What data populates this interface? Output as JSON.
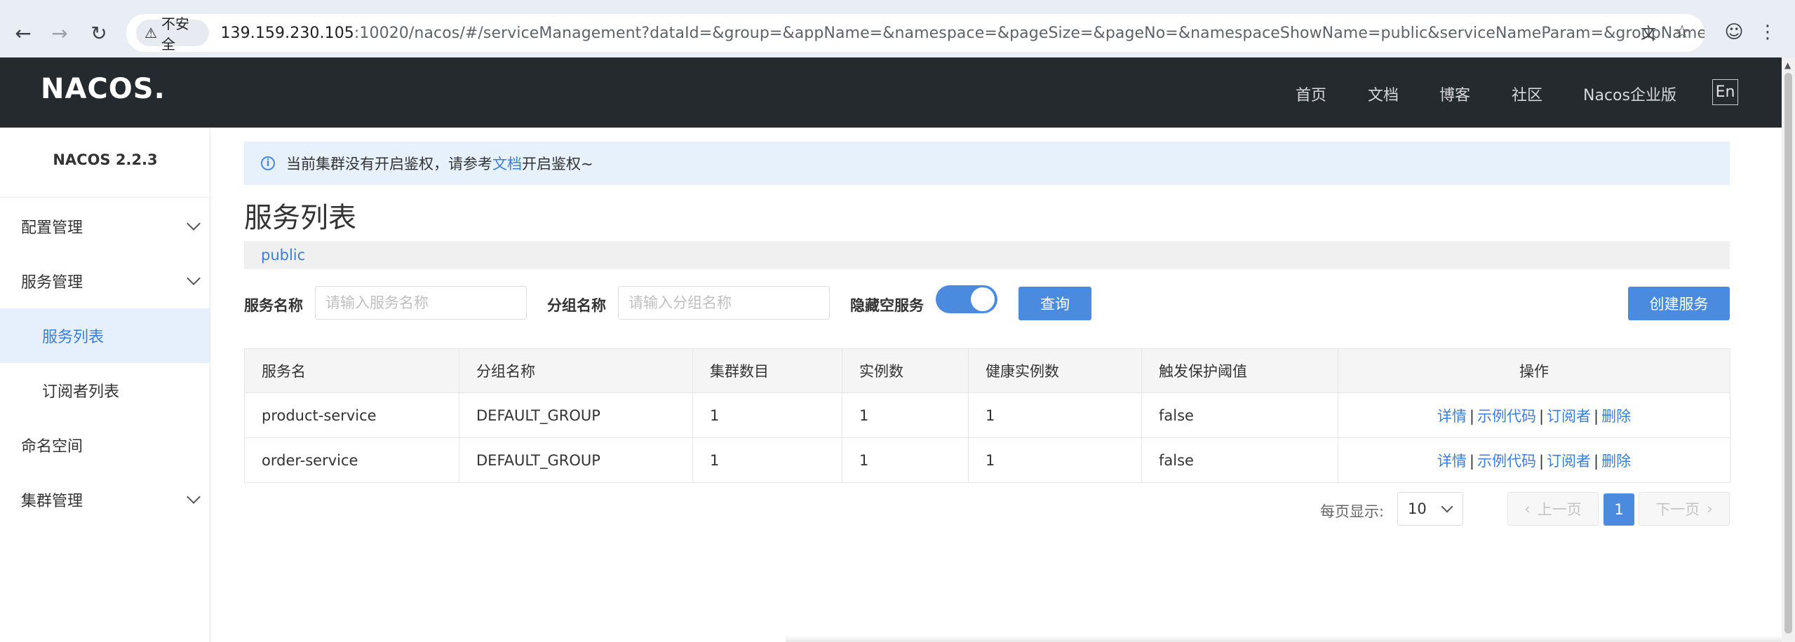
{
  "browser": {
    "security_label": "不安全",
    "url_host": "139.159.230.105",
    "url_rest": ":10020/nacos/#/serviceManagement?dataId=&group=&appName=&namespace=&pageSize=&pageNo=&namespaceShowName=public&serviceNameParam=&groupNameParam="
  },
  "header": {
    "logo": "NACOS.",
    "nav": [
      "首页",
      "文档",
      "博客",
      "社区",
      "Nacos企业版"
    ],
    "lang_button": "En"
  },
  "sidebar": {
    "version": "NACOS 2.2.3",
    "items": [
      {
        "label": "配置管理"
      },
      {
        "label": "服务管理"
      },
      {
        "label": "服务列表"
      },
      {
        "label": "订阅者列表"
      },
      {
        "label": "命名空间"
      },
      {
        "label": "集群管理"
      }
    ]
  },
  "notice": {
    "text_before": "当前集群没有开启鉴权，请参考",
    "link": "文档",
    "text_after": "开启鉴权~"
  },
  "page": {
    "title": "服务列表",
    "namespace": "public"
  },
  "filters": {
    "service_name_label": "服务名称",
    "service_name_placeholder": "请输入服务名称",
    "group_name_label": "分组名称",
    "group_name_placeholder": "请输入分组名称",
    "hide_empty_label": "隐藏空服务",
    "hide_empty_on": true,
    "query_button": "查询",
    "create_button": "创建服务"
  },
  "table": {
    "headers": [
      "服务名",
      "分组名称",
      "集群数目",
      "实例数",
      "健康实例数",
      "触发保护阈值",
      "操作"
    ],
    "rows": [
      {
        "name": "product-service",
        "group": "DEFAULT_GROUP",
        "clusters": "1",
        "instances": "1",
        "healthy": "1",
        "protect": "false"
      },
      {
        "name": "order-service",
        "group": "DEFAULT_GROUP",
        "clusters": "1",
        "instances": "1",
        "healthy": "1",
        "protect": "false"
      }
    ],
    "actions": [
      "详情",
      "示例代码",
      "订阅者",
      "删除"
    ]
  },
  "pagination": {
    "per_page_label": "每页显示:",
    "page_size": "10",
    "prev": "上一页",
    "current": "1",
    "next": "下一页"
  }
}
